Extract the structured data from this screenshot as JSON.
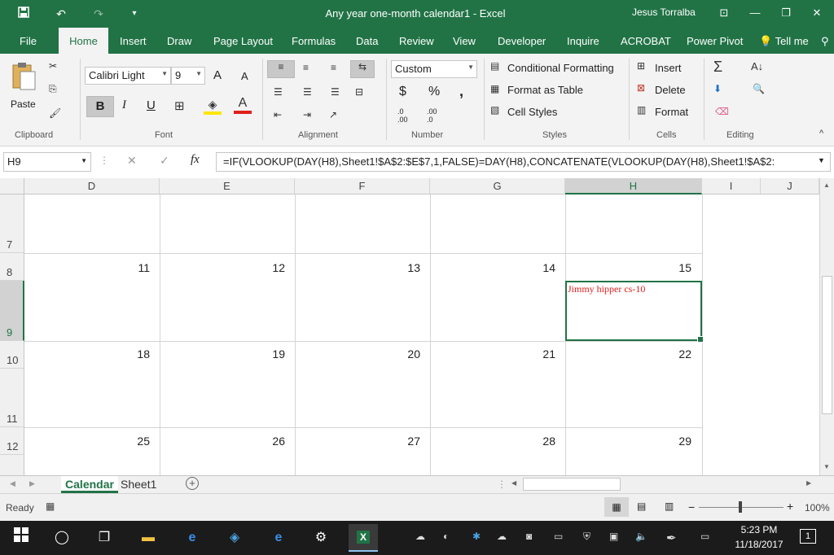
{
  "window": {
    "title": "Any year one-month calendar1  -  Excel",
    "user": "Jesus Torralba"
  },
  "tabs": [
    "File",
    "Home",
    "Insert",
    "Draw",
    "Page Layout",
    "Formulas",
    "Data",
    "Review",
    "View",
    "Developer",
    "Inquire",
    "ACROBAT",
    "Power Pivot",
    "Tell me"
  ],
  "ribbon": {
    "clipboard": {
      "paste": "Paste",
      "label": "Clipboard"
    },
    "font": {
      "name": "Calibri Light",
      "size": "9",
      "bold": "B",
      "italic": "I",
      "underline": "U",
      "grow": "A",
      "shrink": "A",
      "label": "Font"
    },
    "alignment": {
      "label": "Alignment"
    },
    "number": {
      "format": "Custom",
      "currency": "$",
      "percent": "%",
      "comma": ",",
      "inc": ".0 .00",
      "dec": ".00 .0",
      "label": "Number"
    },
    "styles": {
      "cond": "Conditional Formatting",
      "table": "Format as Table",
      "cell": "Cell Styles",
      "label": "Styles"
    },
    "cells": {
      "insert": "Insert",
      "delete": "Delete",
      "format": "Format",
      "label": "Cells"
    },
    "editing": {
      "label": "Editing"
    }
  },
  "formula_bar": {
    "name_box": "H9",
    "fx": "fx",
    "formula": "=IF(VLOOKUP(DAY(H8),Sheet1!$A$2:$E$7,1,FALSE)=DAY(H8),CONCATENATE(VLOOKUP(DAY(H8),Sheet1!$A$2:"
  },
  "grid": {
    "columns": [
      "D",
      "E",
      "F",
      "G",
      "H",
      "I",
      "J"
    ],
    "rows": [
      "7",
      "8",
      "9",
      "10",
      "11",
      "12"
    ],
    "days_row8": [
      "11",
      "12",
      "13",
      "14",
      "15"
    ],
    "days_row10": [
      "18",
      "19",
      "20",
      "21",
      "22"
    ],
    "days_row12": [
      "25",
      "26",
      "27",
      "28",
      "29"
    ],
    "event": "Jimmy hipper cs-10"
  },
  "sheets": [
    "Calendar",
    "Sheet1"
  ],
  "status": {
    "ready": "Ready",
    "zoom": "100%"
  },
  "taskbar": {
    "time": "5:23 PM",
    "date": "11/18/2017",
    "notifications": "1"
  },
  "colors": {
    "excel_green": "#217346",
    "event_red": "#e0201b"
  }
}
